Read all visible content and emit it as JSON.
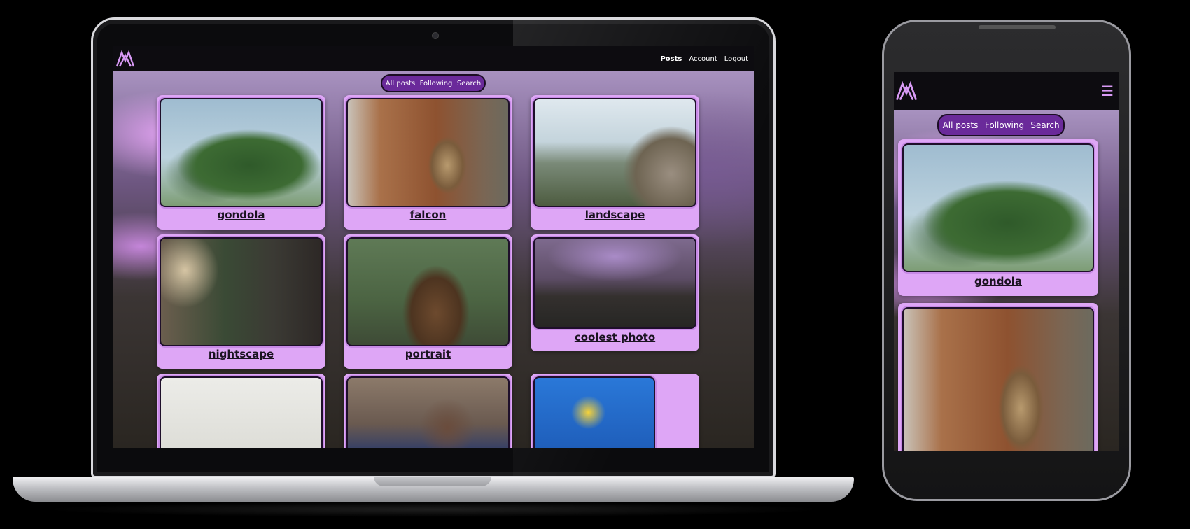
{
  "site": {
    "nav_links": [
      "Posts",
      "Account",
      "Logout"
    ],
    "tabs": [
      "All posts",
      "Following",
      "Search"
    ],
    "menu_icon": "hamburger-icon",
    "logo_icon": "logo-icon"
  },
  "posts": [
    {
      "caption": "gondola"
    },
    {
      "caption": "falcon"
    },
    {
      "caption": "landscape"
    },
    {
      "caption": "nightscape"
    },
    {
      "caption": "portrait"
    },
    {
      "caption": "coolest photo"
    },
    {
      "caption": ""
    },
    {
      "caption": ""
    },
    {
      "caption": ""
    }
  ],
  "colors": {
    "card": "#dea6f6",
    "pill": "#6a2a9a",
    "nav": "#0d0c10"
  }
}
